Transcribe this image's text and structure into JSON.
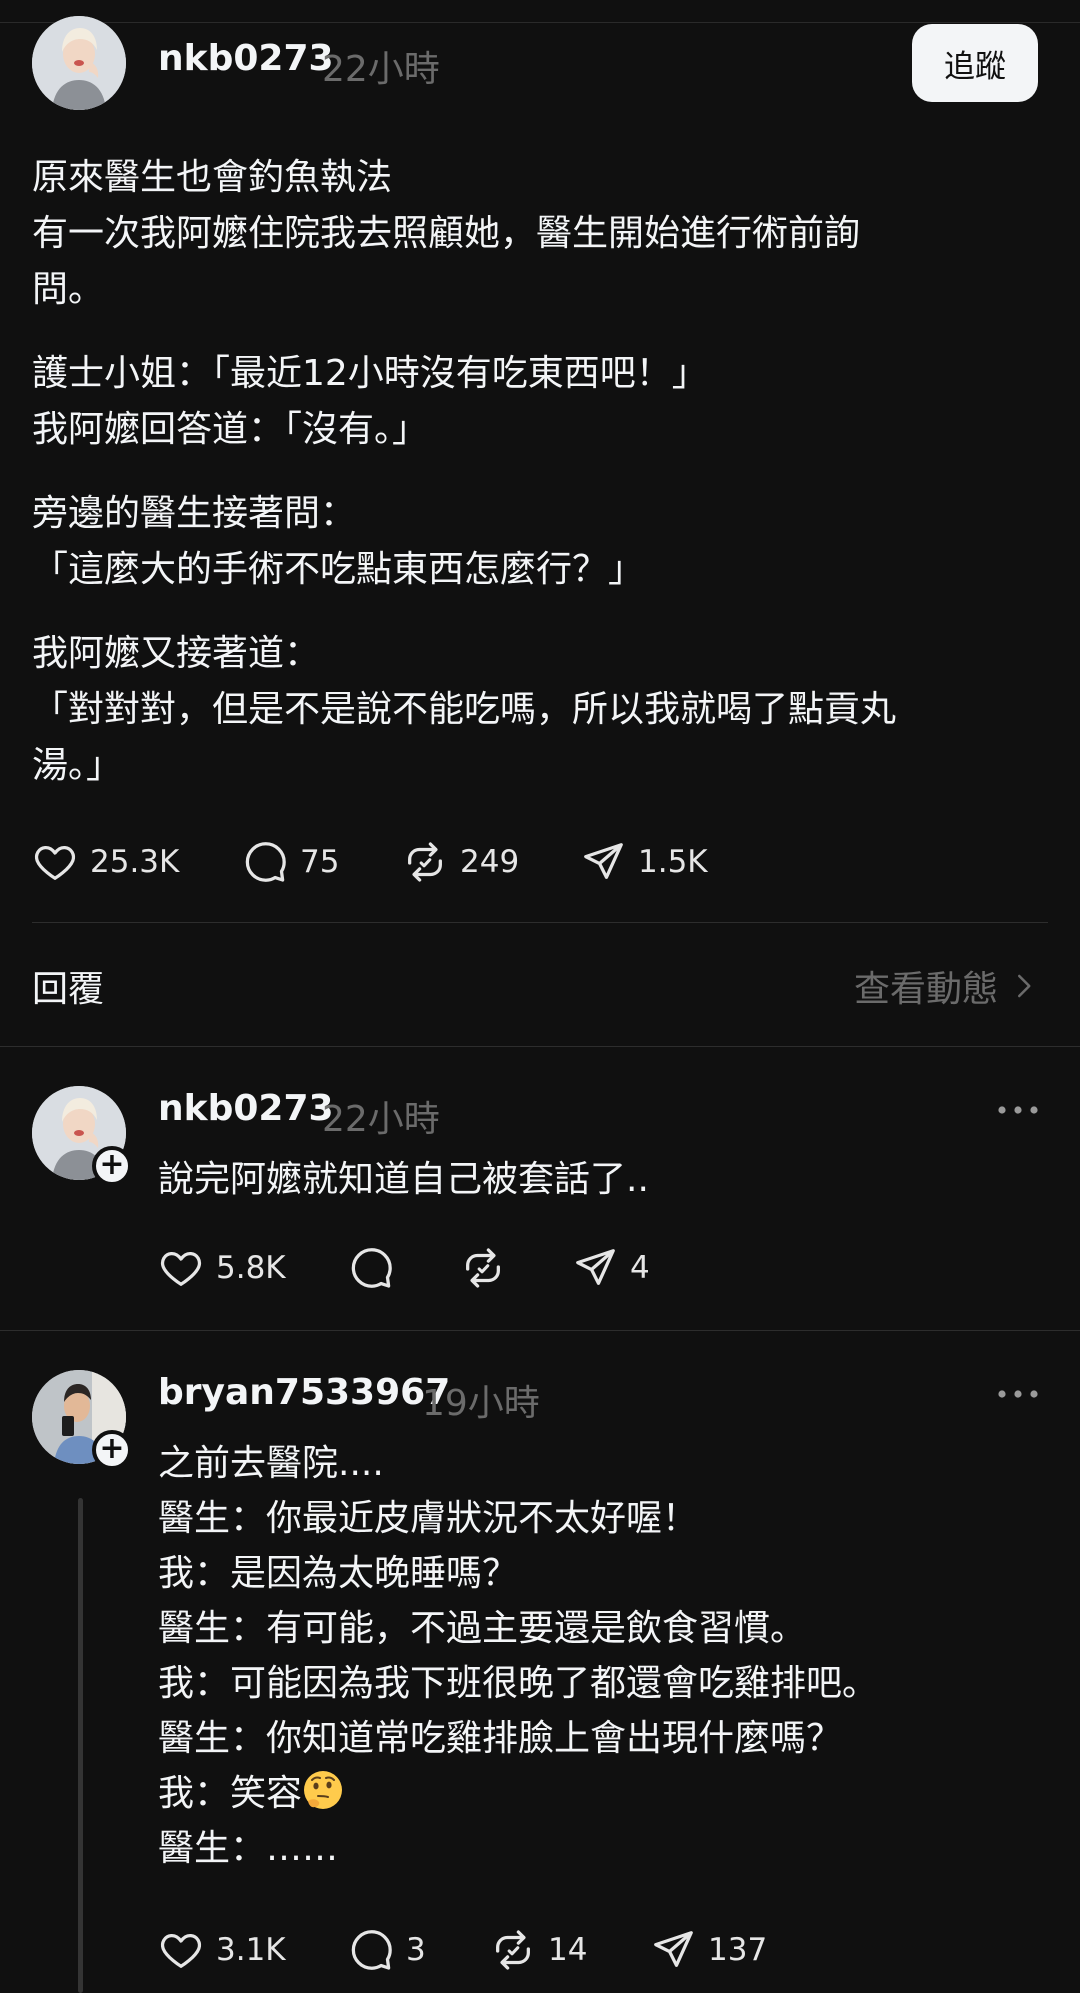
{
  "post": {
    "username": "nkb0273",
    "time": "22小時",
    "follow_label": "追蹤",
    "paragraphs": [
      [
        "原來醫生也會釣魚執法",
        "有一次我阿嬤住院我去照顧她，醫生開始進行術前詢",
        "問。"
      ],
      [
        "護士小姐：「最近12小時沒有吃東西吧！」",
        "我阿嬤回答道：「沒有。」"
      ],
      [
        "旁邊的醫生接著問：",
        "「這麼大的手術不吃點東西怎麼行？」"
      ],
      [
        "我阿嬤又接著道：",
        "「對對對，但是不是說不能吃嗎，所以我就喝了點貢丸",
        "湯。」"
      ]
    ],
    "likes": "25.3K",
    "comments": "75",
    "reposts": "249",
    "shares": "1.5K"
  },
  "replies_bar": {
    "heading": "回覆",
    "view_activity": "查看動態"
  },
  "replies": [
    {
      "username": "nkb0273",
      "time": "22小時",
      "lines": [
        "說完阿嬤就知道自己被套話了.."
      ],
      "likes": "5.8K",
      "comments": "",
      "reposts": "",
      "shares": "4"
    },
    {
      "username": "bryan7533967",
      "time": "19小時",
      "lines": [
        "之前去醫院....",
        "醫生：你最近皮膚狀況不太好喔！",
        "我：是因為太晚睡嗎？",
        "醫生：有可能，不過主要還是飲食習慣。",
        "我：可能因為我下班很晚了都還會吃雞排吧。",
        "醫生：你知道常吃雞排臉上會出現什麼嗎？",
        "我：笑容",
        "醫生：……"
      ],
      "emoji": "thinking-face",
      "likes": "3.1K",
      "comments": "3",
      "reposts": "14",
      "shares": "137"
    }
  ]
}
